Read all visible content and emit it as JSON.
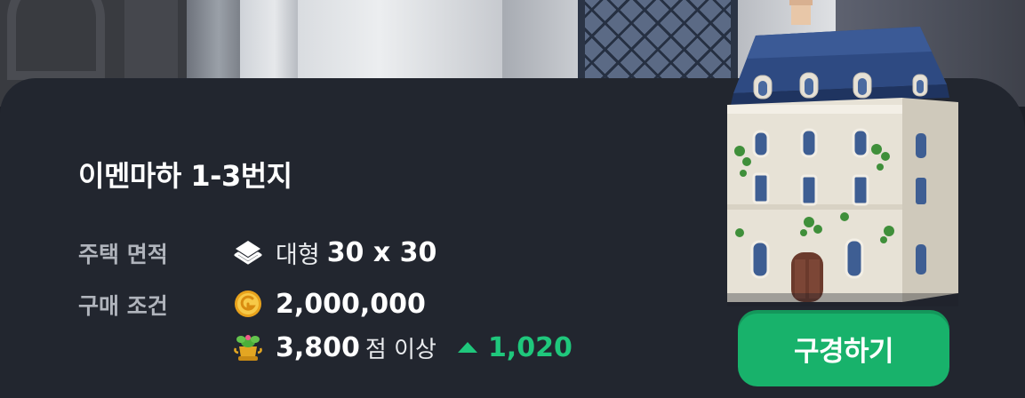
{
  "listing": {
    "title": "이멘마하 1-3번지",
    "area_label": "주택 면적",
    "size_class": "대형",
    "dimensions": "30 x 30",
    "condition_label": "구매 조건",
    "gold_price": "2,000,000",
    "score_required": "3,800",
    "score_suffix": "점 이상",
    "score_delta": "1,020"
  },
  "actions": {
    "purchase_label": "구경하기"
  },
  "icons": {
    "area": "layers-icon",
    "gold": "gold-coin-icon",
    "score": "trophy-plant-icon",
    "delta": "triangle-up-icon"
  },
  "colors": {
    "card_bg": "#22262f",
    "accent_green": "#18b26b",
    "delta_green": "#1fc77c",
    "label_gray": "#b0b4bc"
  }
}
